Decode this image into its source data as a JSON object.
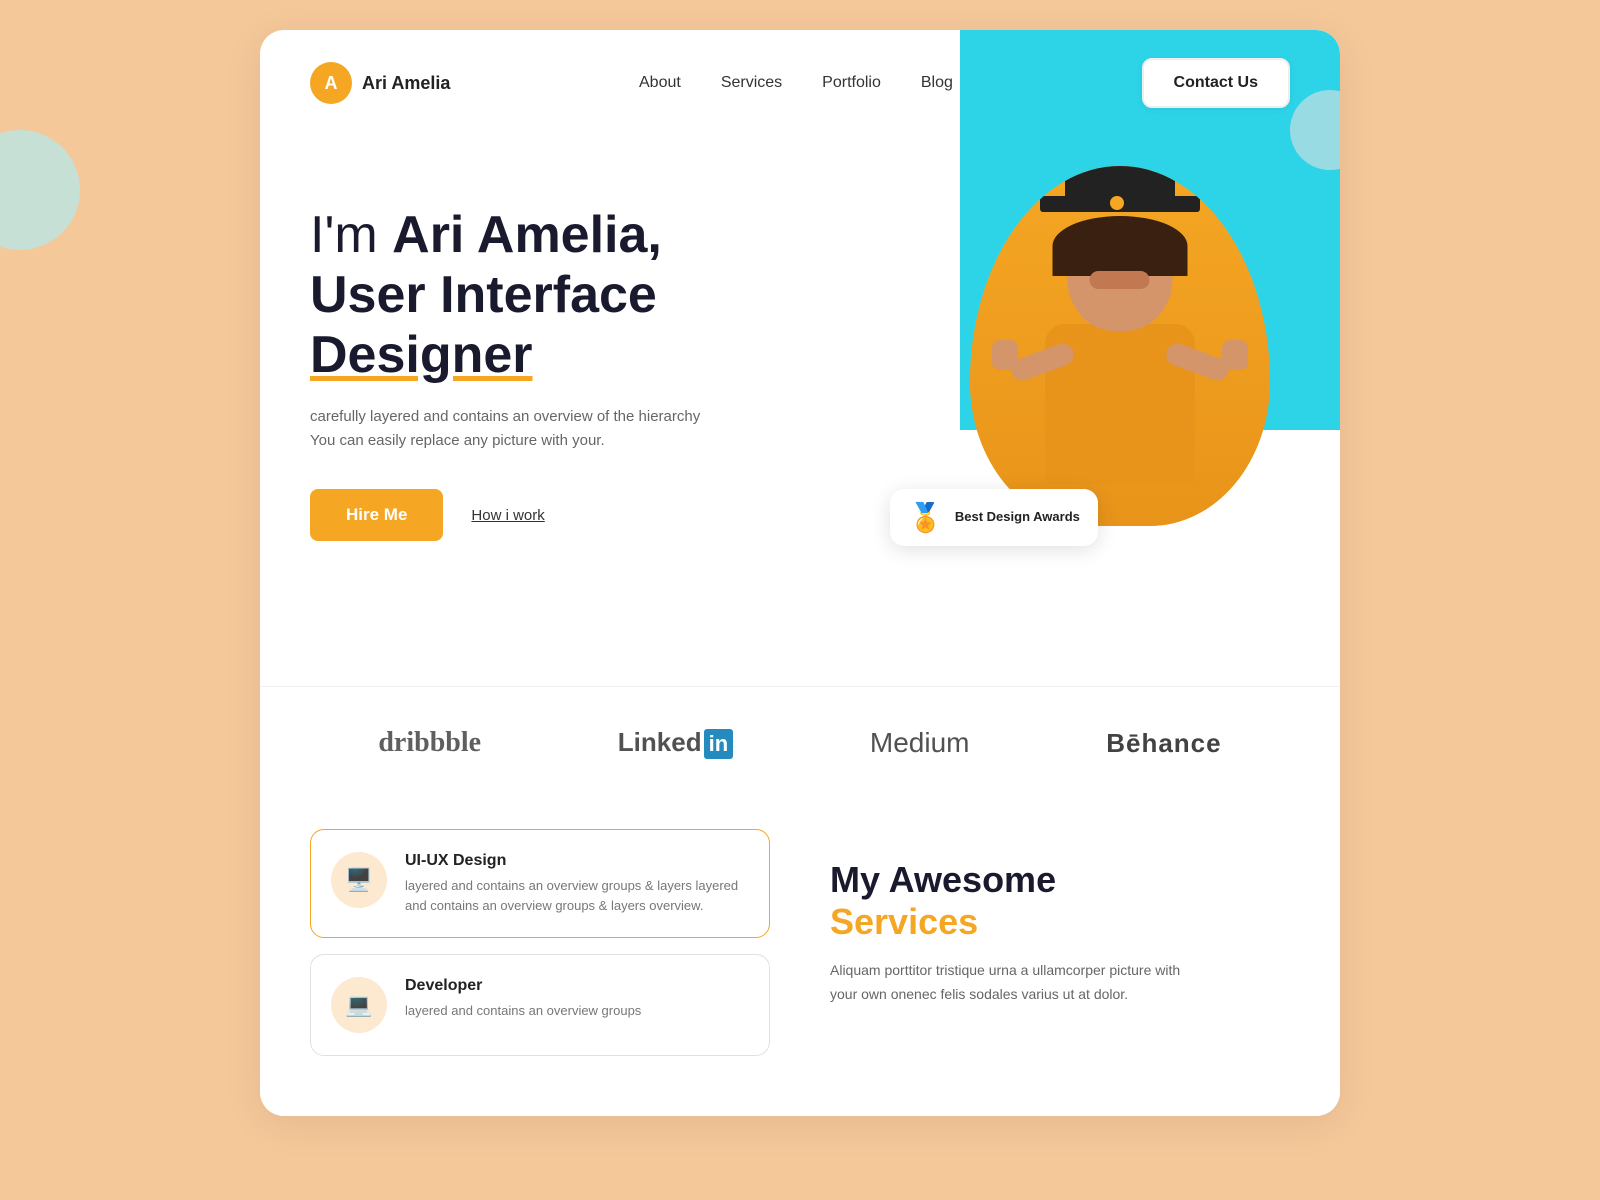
{
  "page": {
    "background": "#f5c89a"
  },
  "navbar": {
    "logo_letter": "A",
    "logo_name": "Ari Amelia",
    "links": [
      {
        "label": "About",
        "id": "about"
      },
      {
        "label": "Services",
        "id": "services"
      },
      {
        "label": "Portfolio",
        "id": "portfolio"
      },
      {
        "label": "Blog",
        "id": "blog"
      }
    ],
    "contact_label": "Contact Us"
  },
  "hero": {
    "intro": "I'm ",
    "name_bold": "Ari Amelia,",
    "line2": "User Interface",
    "line3_underline": "Designer",
    "subtitle_line1": "carefully layered and contains an overview of the hierarchy",
    "subtitle_line2": "You can easily replace any picture with your.",
    "hire_label": "Hire Me",
    "how_label": "How i work",
    "award_text": "Best Design\nAwards"
  },
  "brands": [
    {
      "label": "dribbble",
      "type": "dribbble"
    },
    {
      "label": "Linked",
      "suffix": "in",
      "type": "linkedin"
    },
    {
      "label": "Medium",
      "type": "medium"
    },
    {
      "label": "Bēhance",
      "type": "behance"
    }
  ],
  "services": {
    "heading_line1": "My Awesome",
    "heading_line2": "Services",
    "description": "Aliquam porttitor tristique urna a ullamcorper picture with your own onenec felis sodales varius ut at dolor.",
    "cards": [
      {
        "id": "uiux",
        "title": "UI-UX Design",
        "description": "layered and contains an overview groups & layers layered and contains an overview groups & layers overview.",
        "icon": "🖥️",
        "active": true
      },
      {
        "id": "dev",
        "title": "Developer",
        "description": "layered and contains an overview groups",
        "icon": "💻",
        "active": false
      }
    ]
  }
}
